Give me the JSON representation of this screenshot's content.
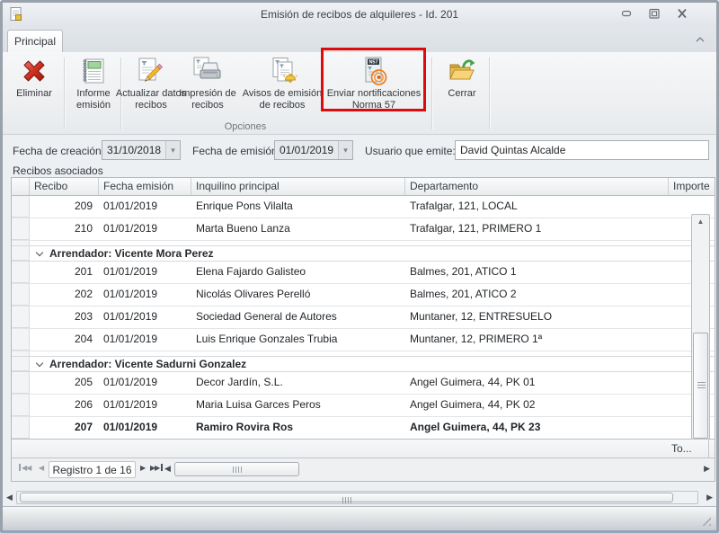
{
  "window": {
    "title": "Emisión de recibos de alquileres - Id. 201"
  },
  "ribbon": {
    "tab": "Principal",
    "group_label": "Opciones",
    "buttons": [
      {
        "label": "Eliminar"
      },
      {
        "label": "Informe emisión"
      },
      {
        "label": "Actualizar datos recibos"
      },
      {
        "label": "Impresión de recibos"
      },
      {
        "label": "Avisos de emisión de recibos"
      },
      {
        "label": "Enviar nortificaciones Norma 57",
        "highlighted": true
      },
      {
        "label": "Cerrar"
      }
    ],
    "highlight_color": "#dd0b0b"
  },
  "form": {
    "fields": [
      {
        "label": "Fecha de creación:",
        "value": "31/10/2018"
      },
      {
        "label": "Fecha de emisión:",
        "value": "01/01/2019"
      },
      {
        "label": "Usuario que emite:",
        "value": "David Quintas Alcalde"
      }
    ]
  },
  "grid": {
    "section_label": "Recibos asociados",
    "columns": [
      "Recibo",
      "Fecha emisión",
      "Inquilino principal",
      "Departamento",
      "Importe"
    ],
    "rows": [
      {
        "type": "data",
        "recibo": "209",
        "fecha": "01/01/2019",
        "inquilino": "Enrique Pons Vilalta",
        "departamento": "Trafalgar, 121, LOCAL",
        "importe": ""
      },
      {
        "type": "data",
        "recibo": "210",
        "fecha": "01/01/2019",
        "inquilino": "Marta Bueno Lanza",
        "departamento": "Trafalgar, 121, PRIMERO 1",
        "importe": ""
      },
      {
        "type": "spacer"
      },
      {
        "type": "group",
        "label": "Arrendador: Vicente Mora Perez"
      },
      {
        "type": "data",
        "recibo": "201",
        "fecha": "01/01/2019",
        "inquilino": "Elena Fajardo Galisteo",
        "departamento": "Balmes, 201, ATICO 1",
        "importe": ""
      },
      {
        "type": "data",
        "recibo": "202",
        "fecha": "01/01/2019",
        "inquilino": "Nicolás Olivares Perelló",
        "departamento": "Balmes, 201, ATICO 2",
        "importe": ""
      },
      {
        "type": "data",
        "recibo": "203",
        "fecha": "01/01/2019",
        "inquilino": "Sociedad General de Autores",
        "departamento": "Muntaner, 12, ENTRESUELO",
        "importe": ""
      },
      {
        "type": "data",
        "recibo": "204",
        "fecha": "01/01/2019",
        "inquilino": "Luis Enrique Gonzales Trubia",
        "departamento": "Muntaner, 12, PRIMERO 1ª",
        "importe": ""
      },
      {
        "type": "spacer"
      },
      {
        "type": "group",
        "label": "Arrendador: Vicente Sadurni Gonzalez"
      },
      {
        "type": "data",
        "recibo": "205",
        "fecha": "01/01/2019",
        "inquilino": "Decor Jardín, S.L.",
        "departamento": "Angel Guimera, 44, PK 01",
        "importe": ""
      },
      {
        "type": "data",
        "recibo": "206",
        "fecha": "01/01/2019",
        "inquilino": "Maria Luisa Garces Peros",
        "departamento": "Angel Guimera, 44, PK 02",
        "importe": ""
      },
      {
        "type": "data",
        "recibo": "207",
        "fecha": "01/01/2019",
        "inquilino": "Ramiro Rovira Ros",
        "departamento": "Angel Guimera, 44, PK 23",
        "importe": "",
        "bold": true
      }
    ],
    "footer_total": "To...",
    "nav": {
      "record_label": "Registro 1 de 16"
    }
  },
  "icons": {
    "delete-icon": "red-x",
    "report-icon": "green-notebook",
    "edit-document-icon": "document-pencil",
    "print-icon": "document-printer",
    "bell-documents-icon": "documents-bell",
    "norma57-icon": "receipt-broadcast-n57",
    "open-folder-icon": "yellow-folder-green-arrow",
    "first": "◀◀",
    "prev": "◀",
    "next": "▶",
    "last": "▶▶",
    "scroll_left": "◀",
    "scroll_right": "▶",
    "scroll_up": "▲",
    "scroll_down": "▼",
    "dropdown": "▾"
  }
}
